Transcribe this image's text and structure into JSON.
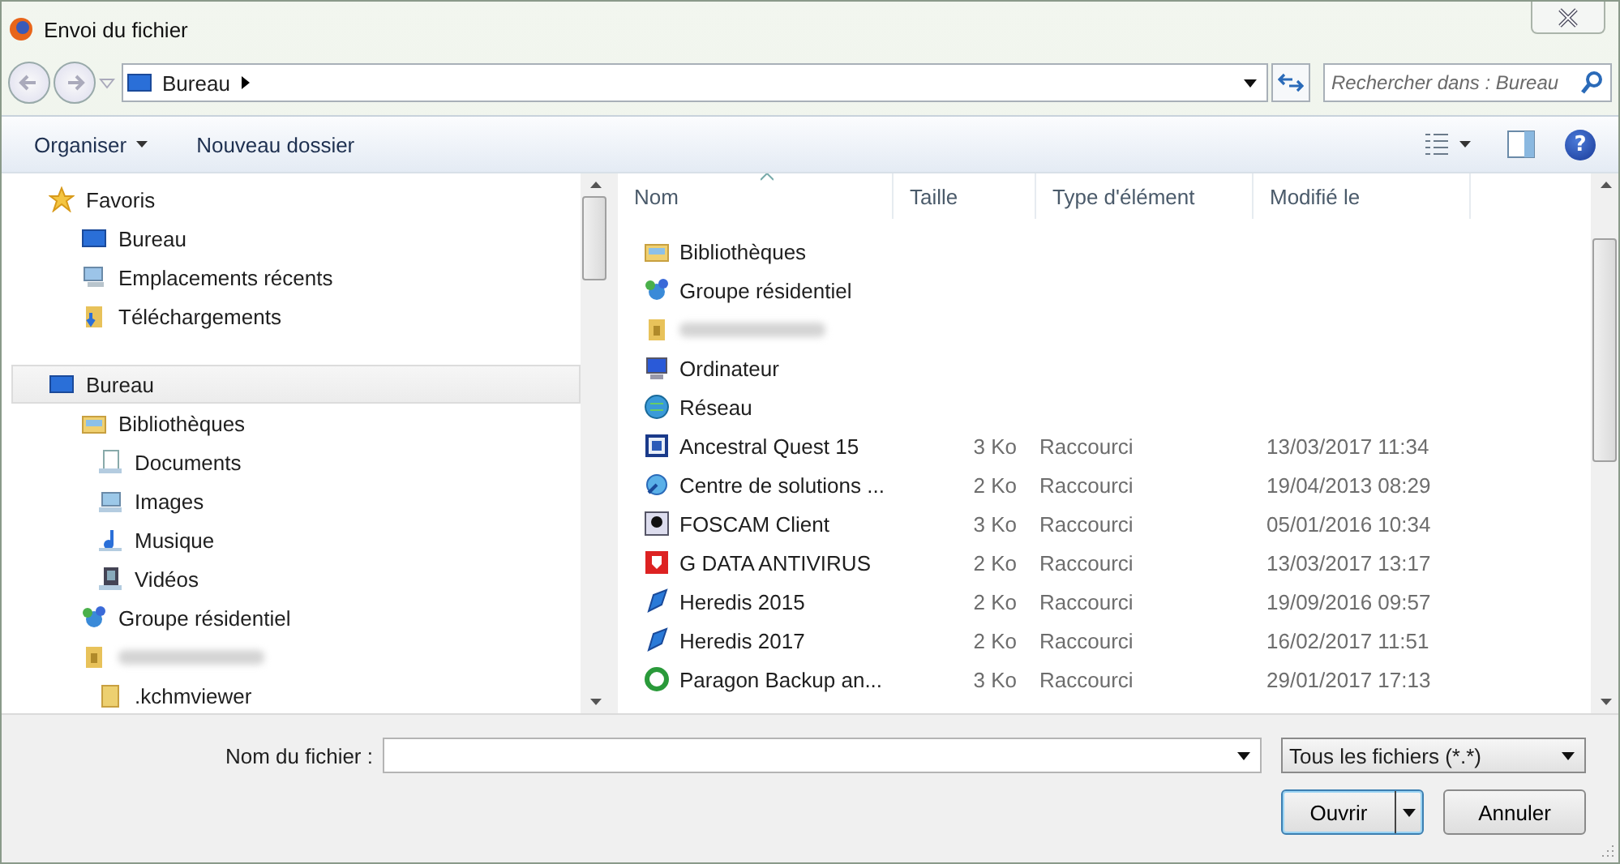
{
  "window": {
    "title": "Envoi du fichier"
  },
  "address_bar": {
    "location": "Bureau"
  },
  "search": {
    "placeholder": "Rechercher dans : Bureau"
  },
  "toolbar": {
    "buttons": [
      "Organiser",
      "Nouveau dossier"
    ],
    "help": "?"
  },
  "sidebar": {
    "items": [
      {
        "label": "Favoris",
        "selected": false,
        "children": [
          {
            "label": "Bureau",
            "selected": false
          },
          {
            "label": "Emplacements récents",
            "selected": false
          },
          {
            "label": "Téléchargements",
            "selected": false
          }
        ]
      },
      {
        "label": "Bureau",
        "selected": true,
        "children": [
          {
            "label": "Bibliothèques",
            "selected": false,
            "children": [
              {
                "label": "Documents",
                "selected": false
              },
              {
                "label": "Images",
                "selected": false
              },
              {
                "label": "Musique",
                "selected": false
              },
              {
                "label": "Vidéos",
                "selected": false
              }
            ]
          },
          {
            "label": "Groupe résidentiel",
            "selected": false
          },
          {
            "kind": "blurred",
            "selected": false,
            "children": [
              {
                "label": ".kchmviewer",
                "selected": false
              }
            ]
          }
        ]
      }
    ]
  },
  "table": {
    "columns": [
      "Nom",
      "Taille",
      "Type d'élément",
      "Modifié le"
    ],
    "rows": [
      {
        "name": "Bibliothèques"
      },
      {
        "name": "Groupe résidentiel"
      },
      {
        "kind": "blurred"
      },
      {
        "name": "Ordinateur"
      },
      {
        "name": "Réseau"
      },
      {
        "name": "Ancestral Quest 15",
        "size": "3 Ko",
        "type": "Raccourci",
        "modified": "13/03/2017 11:34"
      },
      {
        "name": "Centre de solutions ...",
        "size": "2 Ko",
        "type": "Raccourci",
        "modified": "19/04/2013 08:29"
      },
      {
        "name": "FOSCAM Client",
        "size": "3 Ko",
        "type": "Raccourci",
        "modified": "05/01/2016 10:34"
      },
      {
        "name": "G DATA ANTIVIRUS",
        "size": "2 Ko",
        "type": "Raccourci",
        "modified": "13/03/2017 13:17"
      },
      {
        "name": "Heredis 2015",
        "size": "2 Ko",
        "type": "Raccourci",
        "modified": "19/09/2016 09:57"
      },
      {
        "name": "Heredis 2017",
        "size": "2 Ko",
        "type": "Raccourci",
        "modified": "16/02/2017 11:51"
      },
      {
        "name": "Paragon Backup an...",
        "size": "3 Ko",
        "type": "Raccourci",
        "modified": "29/01/2017 17:13"
      }
    ]
  },
  "filename": {
    "label": "Nom du fichier :"
  },
  "filter": {
    "value": "Tous les fichiers (*.*)"
  },
  "buttons": [
    "Ouvrir",
    "Annuler"
  ]
}
